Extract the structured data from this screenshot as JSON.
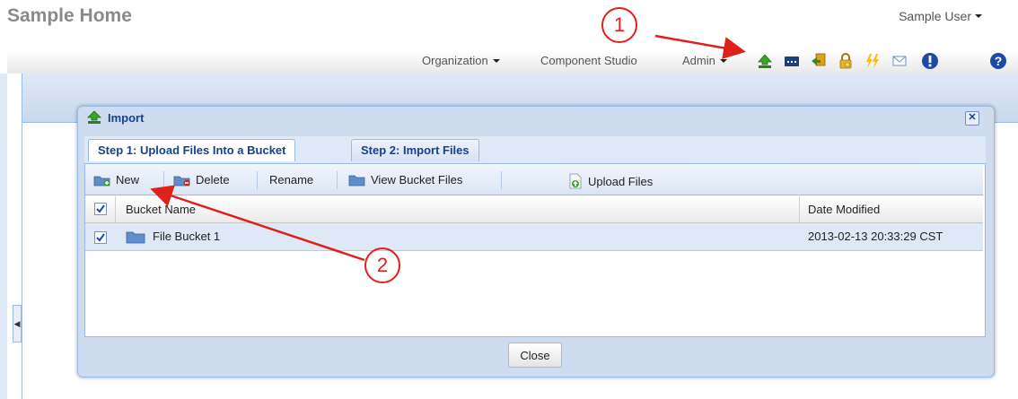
{
  "header": {
    "app_title": "Sample Home",
    "user_label": "Sample User"
  },
  "nav": {
    "organization": "Organization",
    "component_studio": "Component Studio",
    "admin": "Admin"
  },
  "toolbar_icons": [
    "import-icon",
    "bucket-icon",
    "export-icon",
    "lock-icon",
    "lightning-icon",
    "mail-icon",
    "alert-icon",
    "help-icon"
  ],
  "modal": {
    "title": "Import",
    "close_symbol": "✕",
    "tabs": [
      "Step 1: Upload Files Into a Bucket",
      "Step 2: Import Files"
    ],
    "toolbar": {
      "new": "New",
      "delete": "Delete",
      "rename": "Rename",
      "view_bucket_files": "View Bucket Files",
      "upload_files": "Upload Files"
    },
    "grid": {
      "columns": [
        "Bucket Name",
        "Date Modified"
      ],
      "rows": [
        {
          "name": "File Bucket 1",
          "date": "2013-02-13 20:33:29 CST",
          "checked": true
        }
      ],
      "header_checked": true
    },
    "close_button": "Close"
  },
  "annotations": {
    "callout_1": "1",
    "callout_2": "2",
    "color": "#e0201a"
  },
  "colors": {
    "accent_blue": "#15428b",
    "panel_border": "#99bbe8",
    "row_selected": "#dfe8f6"
  }
}
